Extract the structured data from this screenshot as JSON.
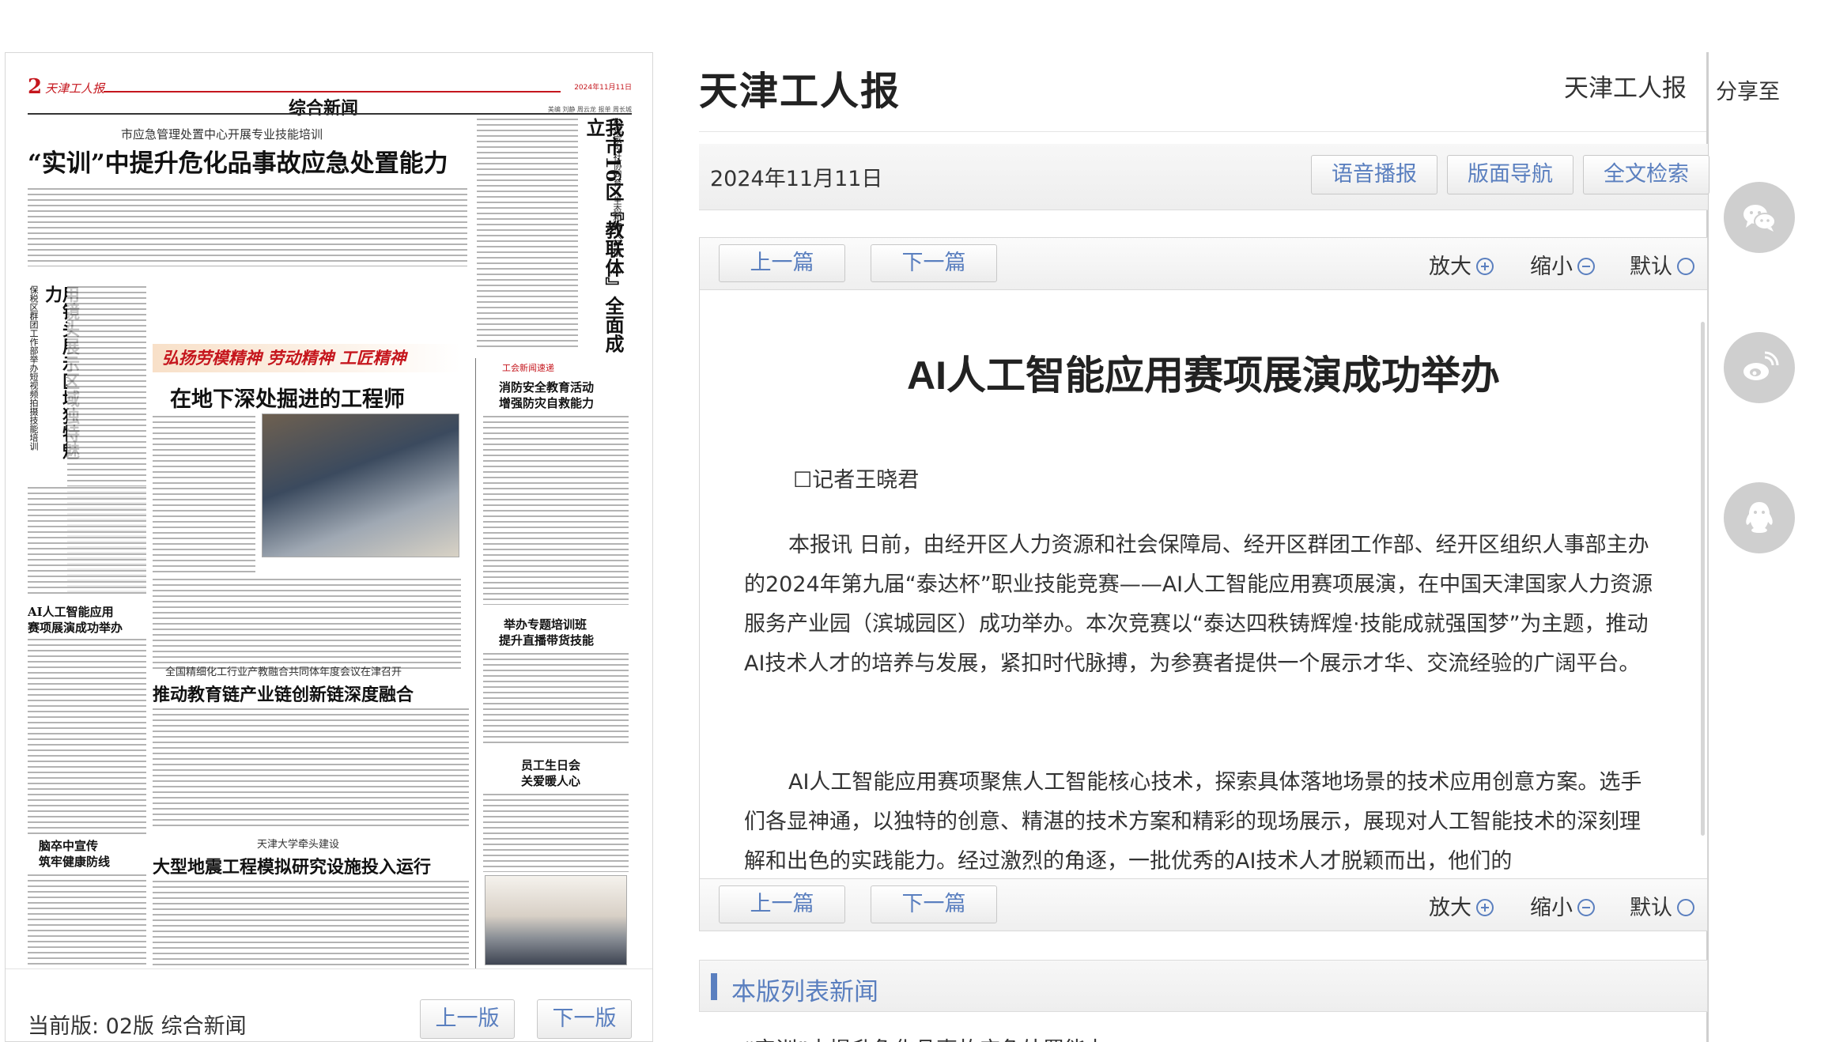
{
  "newspaper": {
    "page_no": "2",
    "brand": "天津工人报",
    "date_line": "2024年11月11日",
    "section": "综合新闻",
    "editors": "美编 刘静 周云龙 报单 周长城",
    "kicker1": "市应急管理处置中心开展专业技能培训",
    "headline1": "“实训”中提升危化品事故应急处置能力",
    "vert_side": "我市16区『教联体』全面成立",
    "vert_side_sub": "构建家校社协同育人生态和育人环境",
    "vert_left": "用镜头展示区域独特魅力",
    "vert_left_sub": "保税区群团工作部举办短视频拍摄技能培训",
    "banner": "弘扬劳模精神 劳动精神 工匠精神",
    "headline2": "在地下深处掘进的工程师",
    "side_kicker": "工会新闻速递",
    "side_head1a": "消防安全教育活动",
    "side_head1b": "增强防灾自救能力",
    "side_head2a": "举办专题培训班",
    "side_head2b": "提升直播带货技能",
    "side_head3a": "员工生日会",
    "side_head3b": "关爱暖人心",
    "left_small_a": "AI人工智能应用",
    "left_small_b": "赛项展演成功举办",
    "kicker3": "全国精细化工行业产教融合共同体年度会议在津召开",
    "headline3": "推动教育链产业链创新链深度融合",
    "left_small2_a": "脑卒中宣传",
    "left_small2_b": "筑牢健康防线",
    "kicker4": "天津大学牵头建设",
    "headline4": "大型地震工程模拟研究设施投入运行"
  },
  "left_footer": {
    "current_edition": "当前版: 02版 综合新闻",
    "prev_edition": "上一版",
    "next_edition": "下一版"
  },
  "site": {
    "title": "天津工人报",
    "link": "天津工人报"
  },
  "date_bar": {
    "date": "2024年11月11日",
    "btn_audio": "语音播报",
    "btn_nav": "版面导航",
    "btn_search": "全文检索"
  },
  "toolbar": {
    "prev": "上一篇",
    "next": "下一篇",
    "zoom_in": "放大",
    "zoom_out": "缩小",
    "zoom_default": "默认"
  },
  "article": {
    "title": "AI人工智能应用赛项展演成功举办",
    "author": "☐记者王晓君",
    "paragraphs": [
      "本报讯 日前，由经开区人力资源和社会保障局、经开区群团工作部、经开区组织人事部主办的2024年第九届“泰达杯”职业技能竞赛——AI人工智能应用赛项展演，在中国天津国家人力资源服务产业园（滨城园区）成功举办。本次竞赛以“泰达四秩铸辉煌·技能成就强国梦”为主题，推动AI技术人才的培养与发展，紧扣时代脉搏，为参赛者提供一个展示才华、交流经验的广阔平台。",
      "AI人工智能应用赛项聚焦人工智能核心技术，探索具体落地场景的技术应用创意方案。选手们各显神通，以独特的创意、精湛的技术方案和精彩的现场展示，展现对人工智能技术的深刻理解和出色的实践能力。经过激烈的角逐，一批优秀的AI技术人才脱颖而出，他们的"
    ]
  },
  "list": {
    "title": "本版列表新闻",
    "first_item": "“实训”中提升危化品事故应急处置能力"
  },
  "share": {
    "label": "分享至",
    "icons": [
      "wechat-icon",
      "weibo-icon",
      "qq-icon"
    ]
  },
  "colors": {
    "accent_blue": "#5a7fbf",
    "paper_red": "#c5161d"
  }
}
